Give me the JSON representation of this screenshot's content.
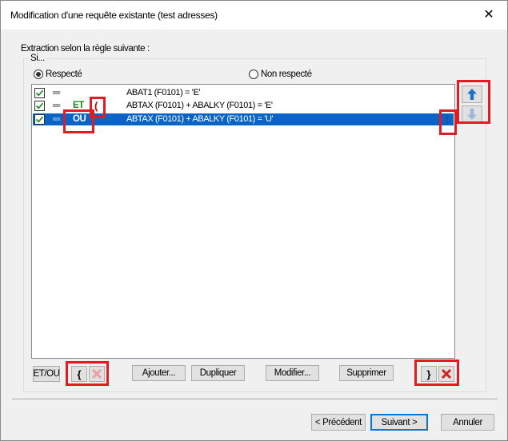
{
  "window": {
    "title": "Modification d'une requête existante (test adresses)",
    "close_glyph": "✕"
  },
  "header_label": "Extraction selon la règle suivante :",
  "group_label": "Si...",
  "radios": {
    "respected": {
      "label": "Respecté",
      "checked": true
    },
    "not_respected": {
      "label": "Non respecté",
      "checked": false
    }
  },
  "rules": [
    {
      "checked": true,
      "equals": "═",
      "operator": "",
      "open_paren": "",
      "expression": "ABAT1 (F0101) = 'E'",
      "close_paren": "",
      "selected": false
    },
    {
      "checked": true,
      "equals": "═",
      "operator": "ET",
      "open_paren": "(",
      "expression": "ABTAX (F0101) + ABALKY (F0101) = 'E'",
      "close_paren": "",
      "selected": false
    },
    {
      "checked": true,
      "equals": "═",
      "operator": "OU",
      "open_paren": "",
      "expression": "ABTAX (F0101) + ABALKY (F0101) = 'U'",
      "close_paren": ")",
      "selected": true
    }
  ],
  "side_buttons": {
    "up_icon": "arrow-up-icon",
    "down_icon": "arrow-down-icon"
  },
  "toolbar": {
    "etou_label": "ET/OU",
    "open_brace_label": "{",
    "close_brace_label": "}",
    "add_label": "Ajouter...",
    "duplicate_label": "Dupliquer",
    "modify_label": "Modifier...",
    "delete_label": "Supprimer"
  },
  "footer": {
    "previous_label": "< Précédent",
    "next_label": "Suivant >",
    "cancel_label": "Annuler"
  },
  "colors": {
    "selection": "#0a64c8",
    "operator_green": "#1a8a1a",
    "paren_red": "#c00000",
    "highlight_red": "#e21b22",
    "arrow_blue": "#1f6fc4"
  }
}
